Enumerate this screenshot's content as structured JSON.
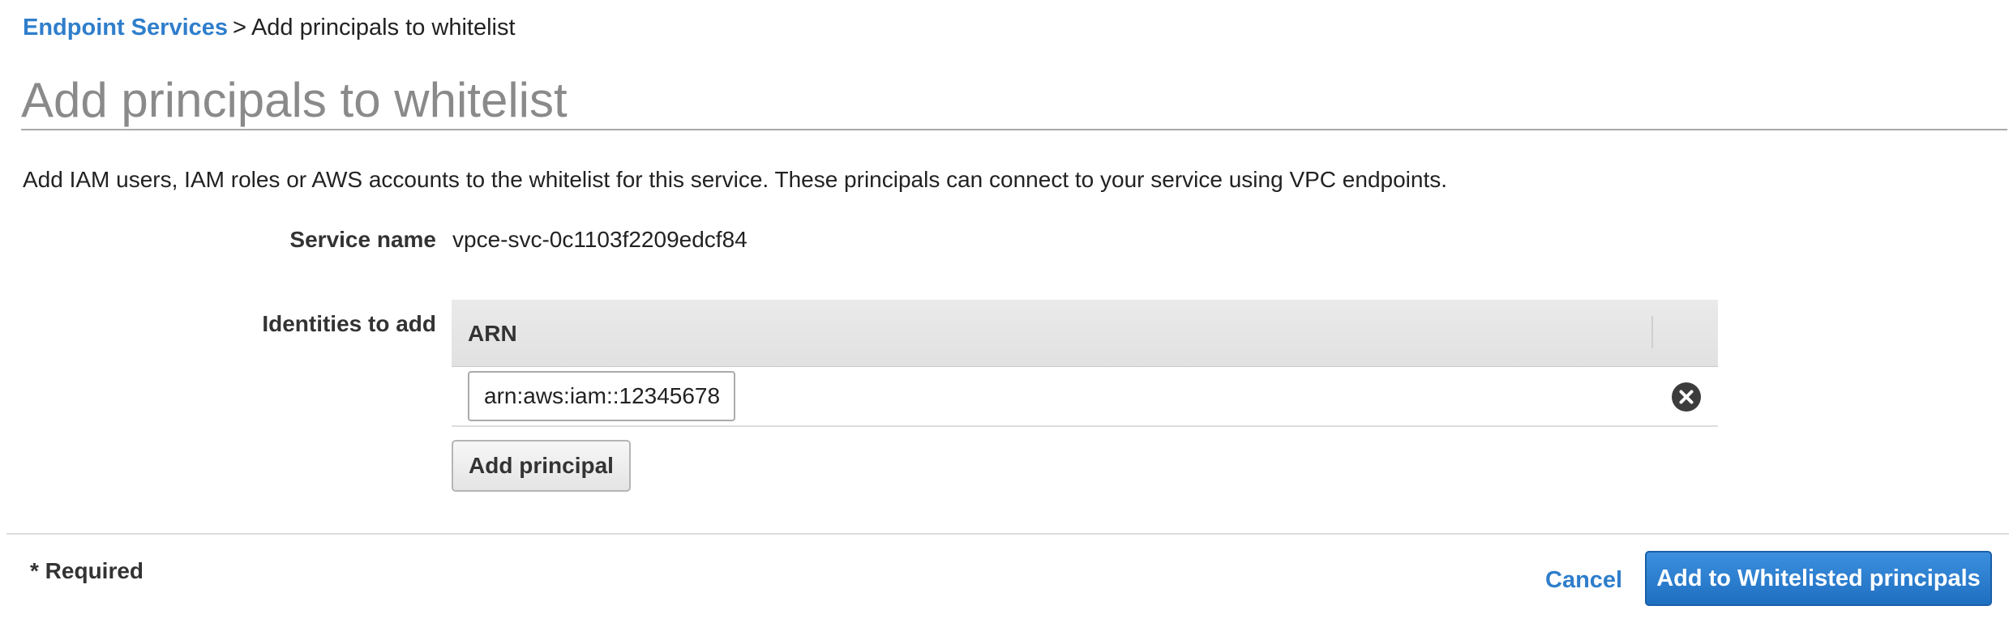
{
  "breadcrumb": {
    "parent": "Endpoint Services",
    "separator": ">",
    "current": "Add principals to whitelist"
  },
  "page": {
    "title": "Add principals to whitelist",
    "description": "Add IAM users, IAM roles or AWS accounts to the whitelist for this service. These principals can connect to your service using VPC endpoints."
  },
  "form": {
    "service_name_label": "Service name",
    "service_name_value": "vpce-svc-0c1103f2209edcf84",
    "identities_label": "Identities to add",
    "table": {
      "column_header": "ARN",
      "rows": [
        {
          "arn": "arn:aws:iam::12345678"
        }
      ]
    },
    "add_principal_label": "Add principal"
  },
  "footer": {
    "required_note": "* Required",
    "cancel_label": "Cancel",
    "submit_label": "Add to Whitelisted principals"
  },
  "icons": {
    "remove_row": "remove-circle-x-icon"
  },
  "colors": {
    "link": "#2f7ecb",
    "primary_button": "#1f6fc1",
    "title": "#8a8a8a"
  }
}
